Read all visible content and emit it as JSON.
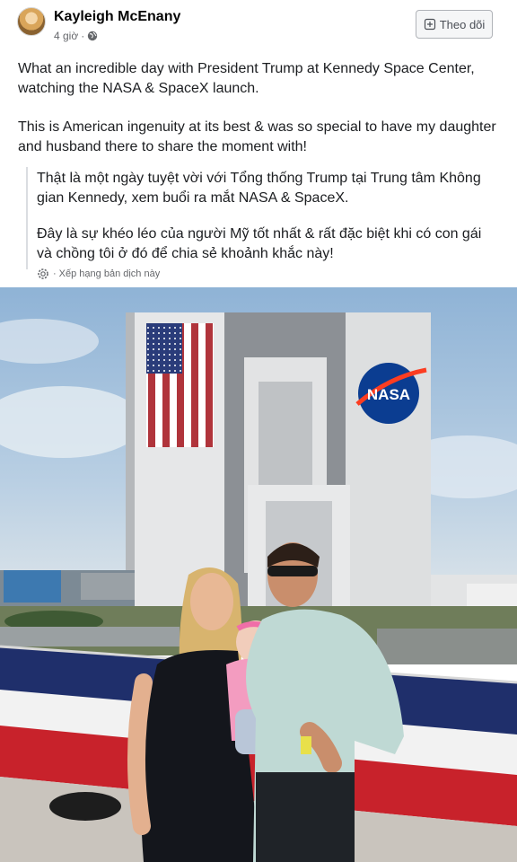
{
  "post": {
    "author": "Kayleigh McEnany",
    "time": "4 giờ",
    "separator": "·",
    "follow_label": "Theo dõi",
    "paragraph1": "What an incredible day with President Trump at Kennedy Space Center, watching the NASA & SpaceX launch.",
    "paragraph2": "This is American ingenuity at its best & was so special to have my daughter and husband there to share the moment with!",
    "translation1": "Thật là một ngày tuyệt vời với Tổng thống Trump tại Trung tâm Không gian Kennedy, xem buổi ra mắt NASA & SpaceX.",
    "translation2": "Đây là sự khéo léo của người Mỹ tốt nhất & rất đặc biệt khi có con gái và chồng tôi ở đó để chia sẻ khoảnh khắc này!",
    "rate_label": "Xếp hạng bản dịch này"
  },
  "photo": {
    "building_logo": "NASA"
  },
  "icons": {
    "privacy": "globe-icon",
    "follow": "add-icon",
    "translation": "gear-icon"
  },
  "colors": {
    "meta_text": "#65676b",
    "nasa_blue": "#0b3d91",
    "nasa_red": "#fc3d21"
  }
}
